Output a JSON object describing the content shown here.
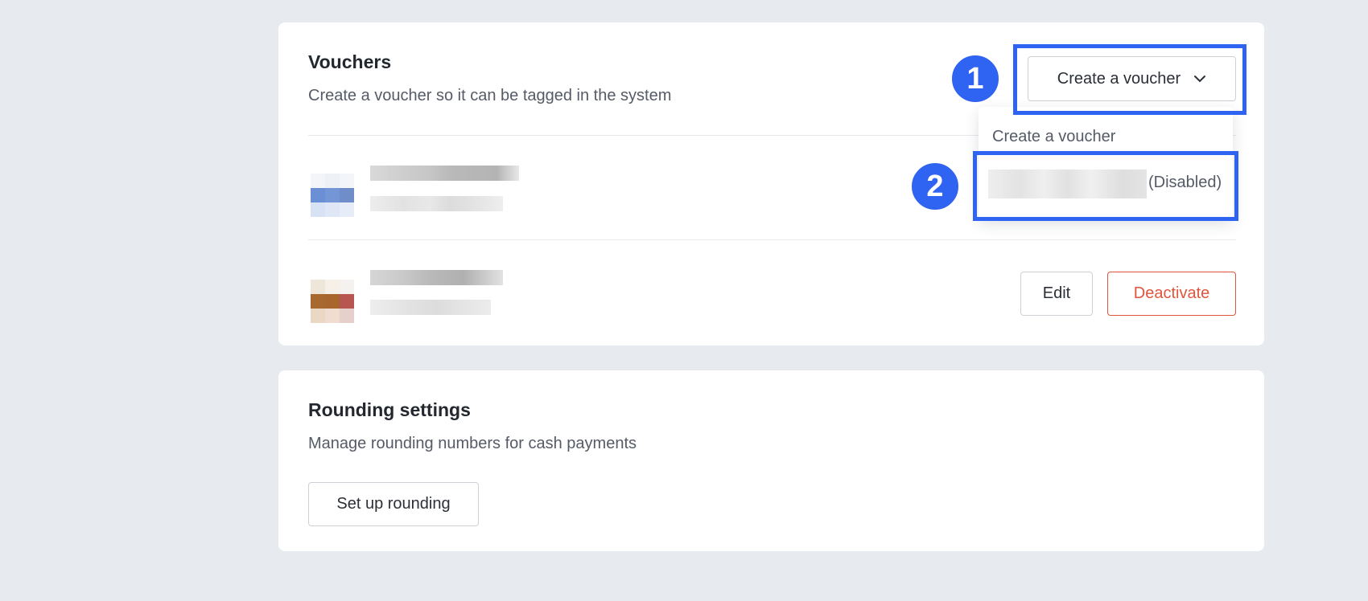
{
  "vouchers": {
    "title": "Vouchers",
    "description": "Create a voucher so it can be tagged in the system",
    "create_button_label": "Create a voucher",
    "dropdown": {
      "items": [
        {
          "label": "Create a voucher"
        },
        {
          "label": "(Disabled)"
        }
      ]
    },
    "rows": [
      {
        "actions": []
      },
      {
        "actions": [
          {
            "label": "Edit"
          },
          {
            "label": "Deactivate"
          }
        ]
      }
    ]
  },
  "rounding": {
    "title": "Rounding settings",
    "description": "Manage rounding numbers for cash payments",
    "setup_button_label": "Set up rounding"
  },
  "annotations": {
    "step1": "1",
    "step2": "2"
  },
  "colors": {
    "page_bg": "#e7eaee",
    "highlight": "#2f63f2",
    "danger": "#e0553c"
  },
  "icons": {
    "dropdown_chevron": "chevron-down-icon"
  }
}
